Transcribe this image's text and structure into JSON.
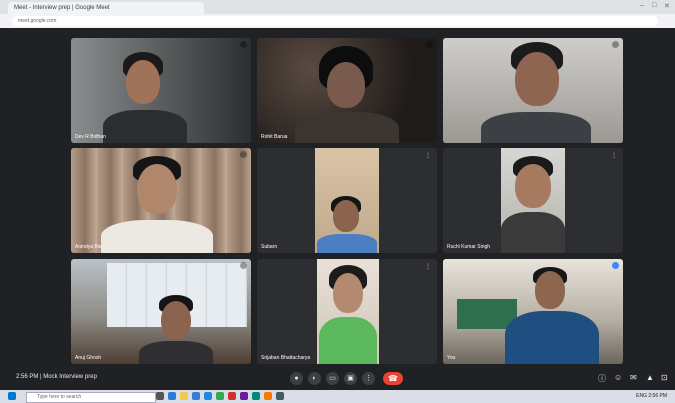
{
  "browser": {
    "tab_title": "Meet - Interview prep | Google Meet",
    "url": "meet.google.com"
  },
  "participants": [
    {
      "name": "Dev R Bidhan"
    },
    {
      "name": "Rohit Barua"
    },
    {
      "name": ""
    },
    {
      "name": "Anindya Bis"
    },
    {
      "name": "Subarn"
    },
    {
      "name": "Ruchi Kumar Singh"
    },
    {
      "name": "Anuj Ghosh"
    },
    {
      "name": "Srijaban Bhattacharya"
    },
    {
      "name": "You"
    }
  ],
  "bottom_bar": {
    "time_and_meeting": "2:56 PM | Mock Interview prep"
  },
  "controls": {
    "mic_icon": "mic-icon",
    "camera_icon": "camera-icon",
    "captions_icon": "captions-icon",
    "present_icon": "present-icon",
    "more_icon": "more-options-icon",
    "end_call_icon": "end-call-icon"
  },
  "taskbar": {
    "search_placeholder": "Type here to search",
    "tray_text": "ENG 2:56 PM"
  },
  "colors": {
    "meet_bg": "#202124",
    "end_call": "#ea4335"
  }
}
